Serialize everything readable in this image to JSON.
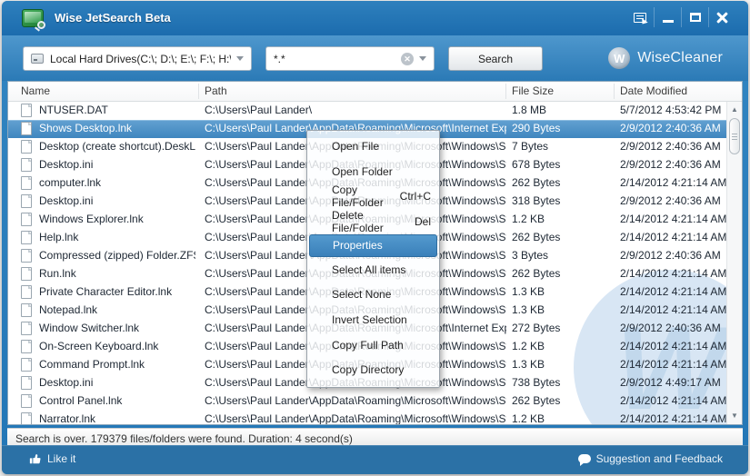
{
  "window": {
    "title": "Wise JetSearch Beta"
  },
  "titlebar": {
    "buttons": {
      "menu": "menu",
      "minimize": "minimize",
      "maximize": "maximize",
      "close": "close"
    }
  },
  "toolbar": {
    "drive_selector": {
      "value": "Local Hard Drives(C:\\; D:\\; E:\\; F:\\; H:\\)"
    },
    "search_input": {
      "value": "*.*"
    },
    "search_button_label": "Search",
    "brand": {
      "initial": "W",
      "name": "WiseCleaner"
    }
  },
  "table": {
    "columns": {
      "name": "Name",
      "path": "Path",
      "size": "File Size",
      "date": "Date Modified"
    },
    "rows": [
      {
        "name": "NTUSER.DAT",
        "path": "C:\\Users\\Paul Lander\\",
        "size": "1.8 MB",
        "date": "5/7/2012 4:53:42 PM",
        "selected": false
      },
      {
        "name": "Shows Desktop.lnk",
        "path": "C:\\Users\\Paul Lander\\AppData\\Roaming\\Microsoft\\Internet Explo...",
        "size": "290 Bytes",
        "date": "2/9/2012 2:40:36 AM",
        "selected": true
      },
      {
        "name": "Desktop (create shortcut).DeskLink",
        "path": "C:\\Users\\Paul Lander\\AppData\\Roaming\\Microsoft\\Windows\\Sen...",
        "size": "7 Bytes",
        "date": "2/9/2012 2:40:36 AM",
        "selected": false
      },
      {
        "name": "Desktop.ini",
        "path": "C:\\Users\\Paul Lander\\AppData\\Roaming\\Microsoft\\Windows\\Star...",
        "size": "678 Bytes",
        "date": "2/9/2012 2:40:36 AM",
        "selected": false
      },
      {
        "name": "computer.lnk",
        "path": "C:\\Users\\Paul Lander\\AppData\\Roaming\\Microsoft\\Windows\\Star...",
        "size": "262 Bytes",
        "date": "2/14/2012 4:21:14 AM",
        "selected": false
      },
      {
        "name": "Desktop.ini",
        "path": "C:\\Users\\Paul Lander\\AppData\\Roaming\\Microsoft\\Windows\\Star...",
        "size": "318 Bytes",
        "date": "2/9/2012 2:40:36 AM",
        "selected": false
      },
      {
        "name": "Windows Explorer.lnk",
        "path": "C:\\Users\\Paul Lander\\AppData\\Roaming\\Microsoft\\Windows\\Star...",
        "size": "1.2 KB",
        "date": "2/14/2012 4:21:14 AM",
        "selected": false
      },
      {
        "name": "Help.lnk",
        "path": "C:\\Users\\Paul Lander\\AppData\\Roaming\\Microsoft\\Windows\\Star...",
        "size": "262 Bytes",
        "date": "2/14/2012 4:21:14 AM",
        "selected": false
      },
      {
        "name": "Compressed (zipped) Folder.ZFSe...",
        "path": "C:\\Users\\Paul Lander\\AppData\\Roaming\\Microsoft\\Windows\\Sen...",
        "size": "3 Bytes",
        "date": "2/9/2012 2:40:36 AM",
        "selected": false
      },
      {
        "name": "Run.lnk",
        "path": "C:\\Users\\Paul Lander\\AppData\\Roaming\\Microsoft\\Windows\\Star...",
        "size": "262 Bytes",
        "date": "2/14/2012 4:21:14 AM",
        "selected": false
      },
      {
        "name": "Private Character Editor.lnk",
        "path": "C:\\Users\\Paul Lander\\AppData\\Roaming\\Microsoft\\Windows\\Star...",
        "size": "1.3 KB",
        "date": "2/14/2012 4:21:14 AM",
        "selected": false
      },
      {
        "name": "Notepad.lnk",
        "path": "C:\\Users\\Paul Lander\\AppData\\Roaming\\Microsoft\\Windows\\Star...",
        "size": "1.3 KB",
        "date": "2/14/2012 4:21:14 AM",
        "selected": false
      },
      {
        "name": "Window Switcher.lnk",
        "path": "C:\\Users\\Paul Lander\\AppData\\Roaming\\Microsoft\\Internet Explo...",
        "size": "272 Bytes",
        "date": "2/9/2012 2:40:36 AM",
        "selected": false
      },
      {
        "name": "On-Screen Keyboard.lnk",
        "path": "C:\\Users\\Paul Lander\\AppData\\Roaming\\Microsoft\\Windows\\Star...",
        "size": "1.2 KB",
        "date": "2/14/2012 4:21:14 AM",
        "selected": false
      },
      {
        "name": "Command Prompt.lnk",
        "path": "C:\\Users\\Paul Lander\\AppData\\Roaming\\Microsoft\\Windows\\Star...",
        "size": "1.3 KB",
        "date": "2/14/2012 4:21:14 AM",
        "selected": false
      },
      {
        "name": "Desktop.ini",
        "path": "C:\\Users\\Paul Lander\\AppData\\Roaming\\Microsoft\\Windows\\Star...",
        "size": "738 Bytes",
        "date": "2/9/2012 4:49:17 AM",
        "selected": false
      },
      {
        "name": "Control Panel.lnk",
        "path": "C:\\Users\\Paul Lander\\AppData\\Roaming\\Microsoft\\Windows\\Star...",
        "size": "262 Bytes",
        "date": "2/14/2012 4:21:14 AM",
        "selected": false
      },
      {
        "name": "Narrator.lnk",
        "path": "C:\\Users\\Paul Lander\\AppData\\Roaming\\Microsoft\\Windows\\Star...",
        "size": "1.2 KB",
        "date": "2/14/2012 4:21:14 AM",
        "selected": false
      }
    ]
  },
  "context_menu": {
    "items": [
      {
        "label": "Open File"
      },
      {
        "label": "Open Folder"
      },
      {
        "label": "Copy File/Folder",
        "shortcut": "Ctrl+C"
      },
      {
        "label": "Delete File/Folder",
        "shortcut": "Del"
      },
      {
        "label": "Properties",
        "highlighted": true
      },
      {
        "label": "Select All items"
      },
      {
        "label": "Select None"
      },
      {
        "label": "Invert Selection"
      },
      {
        "label": "Copy Full Path"
      },
      {
        "label": "Copy Directory"
      }
    ]
  },
  "status_bar": {
    "text": "Search is over. 179379 files/folders were found. Duration: 4 second(s)"
  },
  "footer": {
    "like_label": "Like it",
    "feedback_label": "Suggestion and Feedback"
  },
  "watermark": {
    "letter": "W"
  },
  "colors": {
    "accent": "#3a80ba",
    "titlebar": "#1c6cae",
    "toolbar": "#2b7ab6",
    "footer": "#2b71a6",
    "selection": "#3f86bf"
  }
}
